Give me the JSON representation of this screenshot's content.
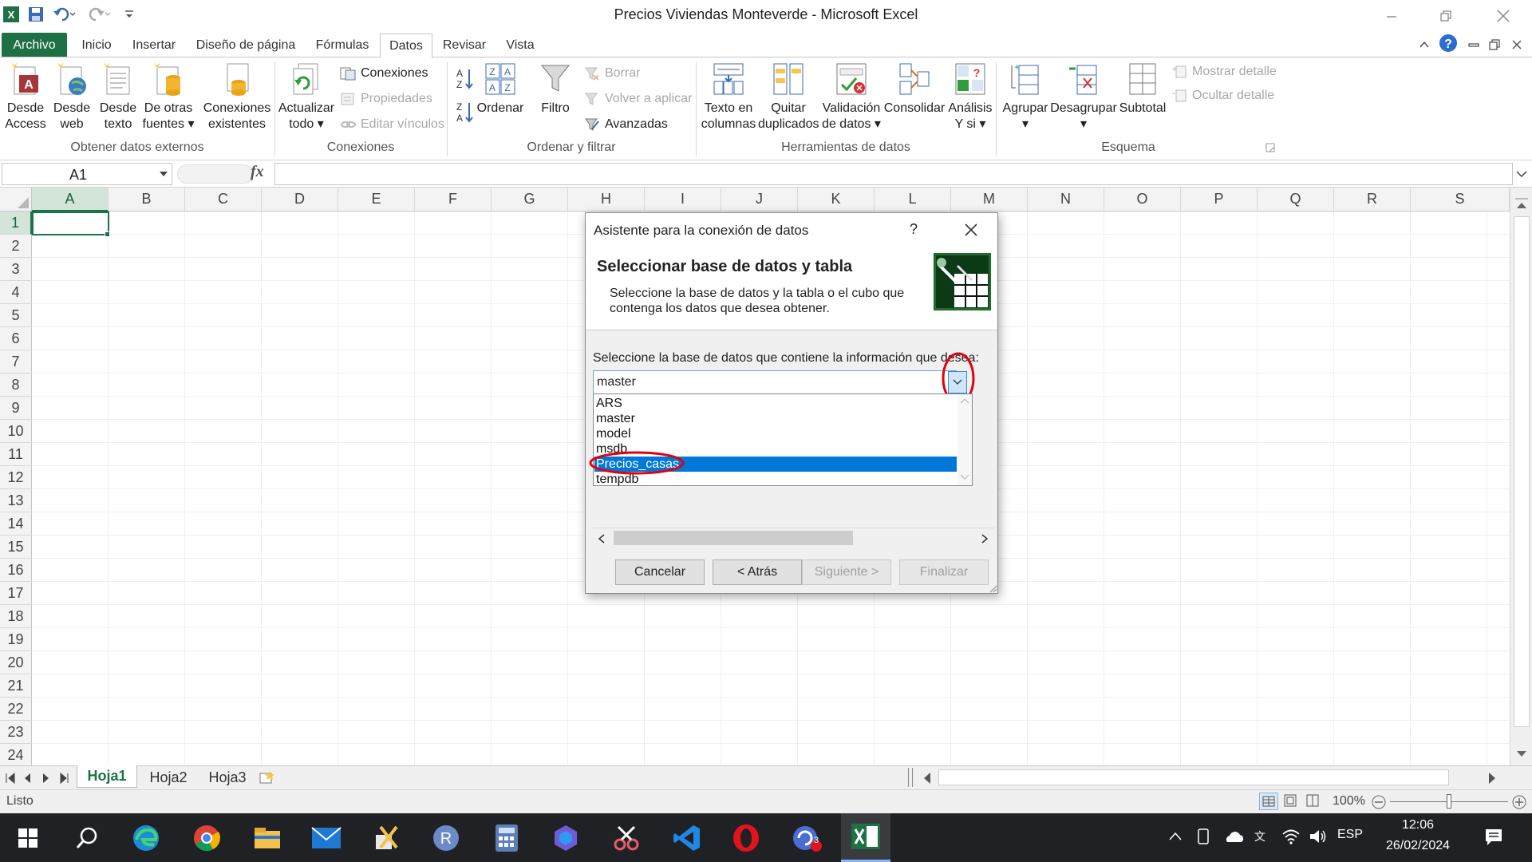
{
  "window": {
    "title": "Precios Viviendas Monteverde - Microsoft Excel"
  },
  "tabs": {
    "archivo": "Archivo",
    "inicio": "Inicio",
    "insertar": "Insertar",
    "diseno": "Diseño de página",
    "formulas": "Fórmulas",
    "datos": "Datos",
    "revisar": "Revisar",
    "vista": "Vista"
  },
  "ribbon": {
    "desde_access": [
      "Desde",
      "Access"
    ],
    "desde_web": [
      "Desde",
      "web"
    ],
    "desde_texto": [
      "Desde",
      "texto"
    ],
    "otras_fuentes": [
      "De otras",
      "fuentes ▾"
    ],
    "conexiones_existentes": [
      "Conexiones",
      "existentes"
    ],
    "group_externos": "Obtener datos externos",
    "actualizar": [
      "Actualizar",
      "todo ▾"
    ],
    "conexiones": "Conexiones",
    "propiedades": "Propiedades",
    "editar_vinculos": "Editar vínculos",
    "group_conexiones": "Conexiones",
    "ordenar": "Ordenar",
    "filtro": "Filtro",
    "borrar": "Borrar",
    "volver_aplicar": "Volver a aplicar",
    "avanzadas": "Avanzadas",
    "group_ordenar": "Ordenar y filtrar",
    "texto_columnas": [
      "Texto en",
      "columnas"
    ],
    "quitar_dup": [
      "Quitar",
      "duplicados"
    ],
    "validacion": [
      "Validación",
      "de datos ▾"
    ],
    "consolidar": "Consolidar",
    "analisis": [
      "Análisis",
      "Y si ▾"
    ],
    "group_herramientas": "Herramientas de datos",
    "agrupar": [
      "Agrupar",
      "▾"
    ],
    "desagrupar": [
      "Desagrupar",
      "▾"
    ],
    "subtotal": "Subtotal",
    "mostrar_detalle": "Mostrar detalle",
    "ocultar_detalle": "Ocultar detalle",
    "group_esquema": "Esquema"
  },
  "formula_bar": {
    "name_box": "A1",
    "fx": "fx",
    "formula": ""
  },
  "columns": [
    "A",
    "B",
    "C",
    "D",
    "E",
    "F",
    "G",
    "H",
    "I",
    "J",
    "K",
    "L",
    "M",
    "N",
    "O",
    "P",
    "Q",
    "R",
    "S"
  ],
  "rows": [
    "1",
    "2",
    "3",
    "4",
    "5",
    "6",
    "7",
    "8",
    "9",
    "10",
    "11",
    "12",
    "13",
    "14",
    "15",
    "16",
    "17",
    "18",
    "19",
    "20",
    "21",
    "22",
    "23",
    "24"
  ],
  "dialog": {
    "title": "Asistente para la conexión de datos",
    "help": "?",
    "heading": "Seleccionar base de datos y tabla",
    "description_1": "Seleccione la base de datos y la tabla o el cubo que",
    "description_2": "contenga los datos que desea obtener.",
    "db_label": "Seleccione la base de datos que contiene la información que desea:",
    "db_value": "master",
    "db_options": [
      "ARS",
      "master",
      "model",
      "msdb",
      "Precios_casas",
      "tempdb"
    ],
    "selected_option": "Precios_casas",
    "btn_cancel": "Cancelar",
    "btn_back": "< Atrás",
    "btn_next": "Siguiente >",
    "btn_finish": "Finalizar"
  },
  "sheets": [
    "Hoja1",
    "Hoja2",
    "Hoja3"
  ],
  "status": {
    "ready": "Listo",
    "zoom": "100%"
  },
  "taskbar": {
    "lang": "ESP",
    "time": "12:06",
    "date": "26/02/2024",
    "badge": "3"
  },
  "colors": {
    "excel_green": "#1e7145",
    "selection_blue": "#0078d7",
    "highlight_red": "#e3000f"
  }
}
